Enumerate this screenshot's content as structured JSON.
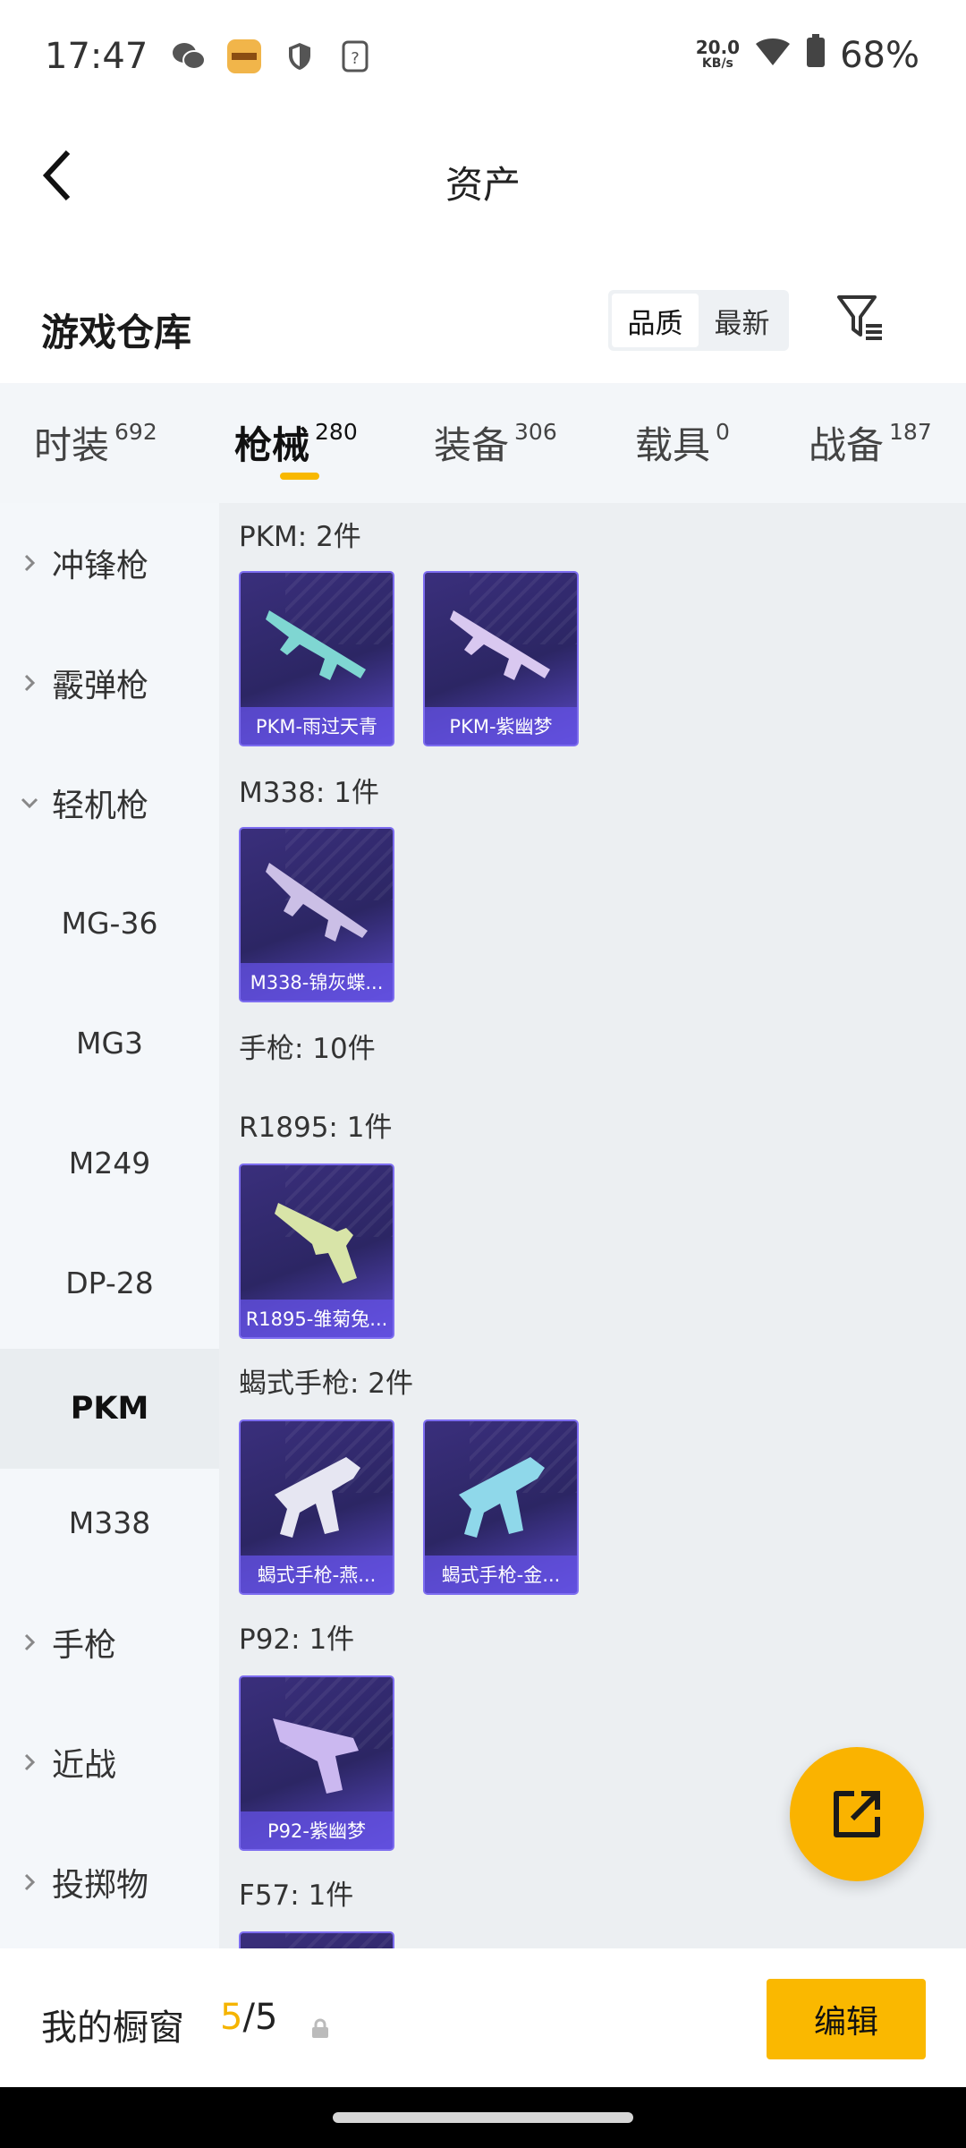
{
  "status": {
    "time": "17:47",
    "battery": "68%",
    "net_speed_value": "20.0",
    "net_speed_unit": "KB/s",
    "icons": [
      "wechat-icon",
      "app-icon",
      "shield-icon",
      "question-icon",
      "wifi-icon",
      "battery-icon"
    ]
  },
  "title": "资产",
  "section": {
    "title": "游戏仓库",
    "sort_options": [
      "品质",
      "最新"
    ],
    "sort_selected": "品质"
  },
  "tabs": [
    {
      "label": "时装",
      "count": "692"
    },
    {
      "label": "枪械",
      "count": "280",
      "active": true
    },
    {
      "label": "装备",
      "count": "306"
    },
    {
      "label": "载具",
      "count": "0"
    },
    {
      "label": "战备",
      "count": "187"
    }
  ],
  "sidebar": [
    {
      "label": "冲锋枪",
      "type": "category",
      "expanded": false
    },
    {
      "label": "霰弹枪",
      "type": "category",
      "expanded": false
    },
    {
      "label": "轻机枪",
      "type": "category",
      "expanded": true
    },
    {
      "label": "MG-36",
      "type": "sub"
    },
    {
      "label": "MG3",
      "type": "sub"
    },
    {
      "label": "M249",
      "type": "sub"
    },
    {
      "label": "DP-28",
      "type": "sub"
    },
    {
      "label": "PKM",
      "type": "sub",
      "selected": true
    },
    {
      "label": "M338",
      "type": "sub"
    },
    {
      "label": "手枪",
      "type": "category",
      "expanded": false
    },
    {
      "label": "近战",
      "type": "category",
      "expanded": false
    },
    {
      "label": "投掷物",
      "type": "category",
      "expanded": false
    }
  ],
  "groups": [
    {
      "label": "PKM: 2件",
      "items": [
        {
          "name": "PKM-雨过天青",
          "color": "#7fd6d2"
        },
        {
          "name": "PKM-紫幽梦",
          "color": "#d9c8f0"
        }
      ]
    },
    {
      "label": "M338: 1件",
      "items": [
        {
          "name": "M338-锦灰蝶...",
          "color": "#cbbfe6"
        }
      ]
    },
    {
      "label": "手枪: 10件",
      "items": []
    },
    {
      "label": "R1895: 1件",
      "items": [
        {
          "name": "R1895-雏菊兔...",
          "color": "#d8e4a8"
        }
      ]
    },
    {
      "label": "蝎式手枪: 2件",
      "items": [
        {
          "name": "蝎式手枪-燕...",
          "color": "#e6e6f2"
        },
        {
          "name": "蝎式手枪-金...",
          "color": "#8fd8ea"
        }
      ]
    },
    {
      "label": "P92: 1件",
      "items": [
        {
          "name": "P92-紫幽梦",
          "color": "#cbb8f0"
        }
      ]
    },
    {
      "label": "F57: 1件",
      "items": []
    }
  ],
  "colors": {
    "accent": "#fab800",
    "card_bg": "#2c2664",
    "card_border": "#7d6df0"
  },
  "bottom": {
    "label": "我的橱窗",
    "count": "5",
    "separator": "/",
    "total": "5",
    "edit": "编辑"
  },
  "fab_icon": "share-icon"
}
